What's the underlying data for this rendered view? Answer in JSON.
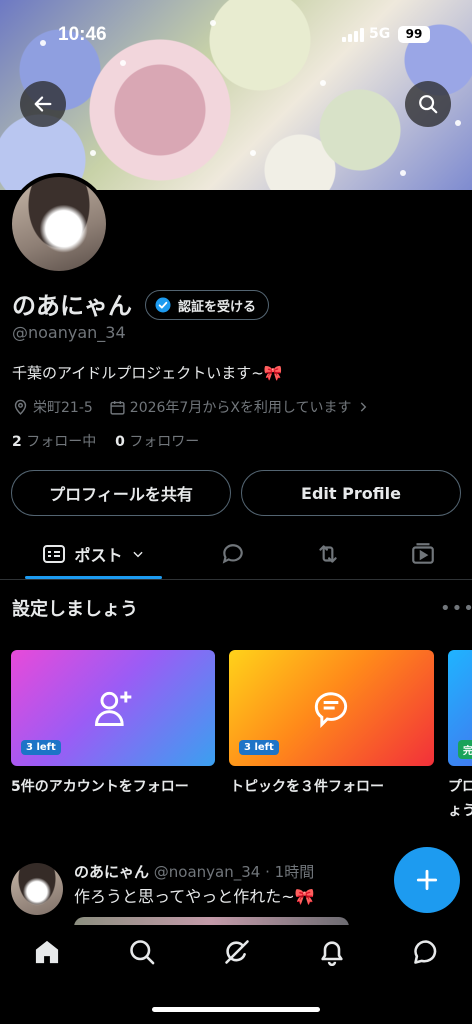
{
  "status_bar": {
    "time": "10:46",
    "network": "5G",
    "battery": "99"
  },
  "profile": {
    "name": "のあにゃん",
    "verify_label": "認証を受ける",
    "handle": "@noanyan_34",
    "bio": "千葉のアイドルプロジェクトいます~🎀",
    "location": "栄町21-5",
    "joined": "2026年7月からXを利用しています",
    "following_count": "2",
    "following_label": "フォロー中",
    "followers_count": "0",
    "followers_label": "フォロワー"
  },
  "actions": {
    "share_label": "プロフィールを共有",
    "edit_label": "Edit Profile"
  },
  "tabs": {
    "posts_label": "ポスト"
  },
  "setup": {
    "title": "設定しましょう",
    "cards": [
      {
        "badge": "3 left",
        "label": "5件のアカウントをフォロー",
        "icon": "add-user-icon"
      },
      {
        "badge": "3 left",
        "label": "トピックを３件フォロー",
        "icon": "topic-bubble-icon"
      },
      {
        "badge": "完",
        "label": "プロ",
        "label2": "ょう"
      }
    ]
  },
  "post": {
    "author": "のあにゃん",
    "handle_time": "@noanyan_34 · 1時間",
    "text": "作ろうと思ってやっと作れた~🎀"
  },
  "colors": {
    "accent": "#1d9bf0",
    "muted": "#71767b",
    "border": "#536471",
    "background": "#000000"
  }
}
